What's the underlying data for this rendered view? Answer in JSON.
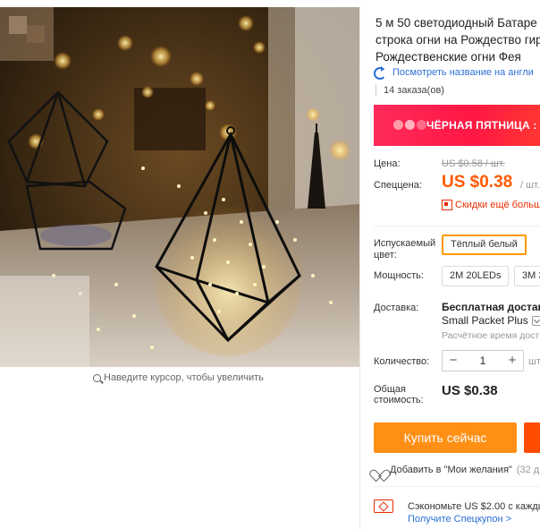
{
  "gallery": {
    "image_alt": "Fairy string lights in geometric glass terrariums",
    "zoom_hint": "Наведите курсор, чтобы увеличить"
  },
  "product": {
    "title_lines": [
      "5 м 50 светодиодный Батаре",
      "строка огни на Рождество гир",
      "Рождественские огни Фея"
    ],
    "translate_link": "Посмотреть название на англи",
    "orders": "14 заказа(ов)"
  },
  "promo": {
    "label": "ЧЁРНАЯ ПЯТНИЦА :"
  },
  "pricing": {
    "old_label": "Цена:",
    "old_price": "US $0.58 / шт.",
    "price_label": "Спеццена:",
    "price": "US $0.38",
    "price_unit": "/ шт.",
    "discount_link": "Скидки ещё больш"
  },
  "options": {
    "color_label": "Испускаемый цвет:",
    "color_selected": "Тёплый белый",
    "power_label": "Мощность:",
    "power_options": [
      "2M 20LEDs",
      "3M 3"
    ]
  },
  "shipping": {
    "label": "Доставка:",
    "title": "Бесплатная доставка",
    "method": "Small Packet Plus",
    "time": "Расчётное время дост"
  },
  "quantity": {
    "label": "Количество:",
    "minus": "−",
    "value": "1",
    "plus": "+",
    "more": "шт"
  },
  "total": {
    "label": "Общая стоимость:",
    "value": "US $0.38"
  },
  "actions": {
    "buy_now": "Купить сейчас",
    "wishlist": "Добавить в \"Мои желания\"",
    "wishlist_count": "(32 д"
  },
  "coupon": {
    "save_text": "Сэкономьте US $2.00 с кажды",
    "link": "Получите Спецкупон >"
  },
  "colors": {
    "price": "#ff5a00",
    "buy_button": "#ff9015",
    "cart_button": "#ff4d00",
    "promo": "#ff1744",
    "link": "#2a6fd6",
    "selected_border": "#ff9900"
  }
}
